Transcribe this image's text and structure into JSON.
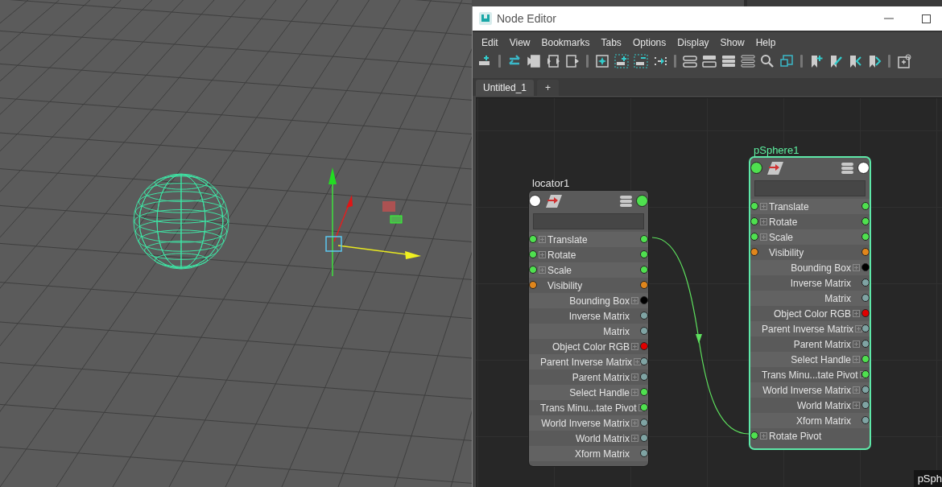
{
  "window": {
    "title": "Node Editor"
  },
  "menu": [
    "Edit",
    "View",
    "Bookmarks",
    "Tabs",
    "Options",
    "Display",
    "Show",
    "Help"
  ],
  "tabs": [
    {
      "label": "Untitled_1",
      "selected": true
    }
  ],
  "add_tab": "+",
  "nodes": [
    {
      "name": "locator1",
      "selected": false,
      "in_port": {
        "color": "#ffffff"
      },
      "out_port": {
        "color": "#4fe04f"
      },
      "rows": [
        {
          "kind": "both",
          "label": "Translate",
          "expandable": true,
          "in_port": {
            "color": "#4fe04f"
          },
          "out_port": {
            "color": "#4fe04f"
          }
        },
        {
          "kind": "both",
          "label": "Rotate",
          "expandable": true,
          "in_port": {
            "color": "#4fe04f"
          },
          "out_port": {
            "color": "#4fe04f"
          }
        },
        {
          "kind": "both",
          "label": "Scale",
          "expandable": true,
          "in_port": {
            "color": "#4fe04f"
          },
          "out_port": {
            "color": "#4fe04f"
          }
        },
        {
          "kind": "both",
          "label": "Visibility",
          "expandable": false,
          "in_port": {
            "color": "#e0861c"
          },
          "out_port": {
            "color": "#e0861c"
          }
        },
        {
          "kind": "output",
          "label": "Bounding Box",
          "expandable": true,
          "out_port": {
            "color": "#000000"
          }
        },
        {
          "kind": "output",
          "label": "Inverse Matrix",
          "expandable": false,
          "out_port": {
            "color": "#7fa3a3"
          }
        },
        {
          "kind": "output",
          "label": "Matrix",
          "expandable": false,
          "out_port": {
            "color": "#7fa3a3"
          }
        },
        {
          "kind": "output",
          "label": "Object Color RGB",
          "expandable": true,
          "out_port": {
            "color": "#e00000"
          }
        },
        {
          "kind": "output",
          "label": "Parent Inverse Matrix",
          "expandable": true,
          "out_port": {
            "color": "#7fa3a3"
          }
        },
        {
          "kind": "output",
          "label": "Parent Matrix",
          "expandable": true,
          "out_port": {
            "color": "#7fa3a3"
          }
        },
        {
          "kind": "output",
          "label": "Select Handle",
          "expandable": true,
          "out_port": {
            "color": "#4fe04f"
          }
        },
        {
          "kind": "output",
          "label": "Trans Minu...tate Pivot",
          "expandable": true,
          "out_port": {
            "color": "#4fe04f"
          }
        },
        {
          "kind": "output",
          "label": "World Inverse Matrix",
          "expandable": true,
          "out_port": {
            "color": "#7fa3a3"
          }
        },
        {
          "kind": "output",
          "label": "World Matrix",
          "expandable": true,
          "out_port": {
            "color": "#7fa3a3"
          }
        },
        {
          "kind": "output",
          "label": "Xform Matrix",
          "expandable": false,
          "out_port": {
            "color": "#7fa3a3"
          }
        }
      ]
    },
    {
      "name": "pSphere1",
      "selected": true,
      "in_port": {
        "color": "#4fe04f"
      },
      "out_port": {
        "color": "#ffffff"
      },
      "rows": [
        {
          "kind": "both",
          "label": "Translate",
          "expandable": true,
          "in_port": {
            "color": "#4fe04f"
          },
          "out_port": {
            "color": "#4fe04f"
          }
        },
        {
          "kind": "both",
          "label": "Rotate",
          "expandable": true,
          "in_port": {
            "color": "#4fe04f"
          },
          "out_port": {
            "color": "#4fe04f"
          }
        },
        {
          "kind": "both",
          "label": "Scale",
          "expandable": true,
          "in_port": {
            "color": "#4fe04f"
          },
          "out_port": {
            "color": "#4fe04f"
          }
        },
        {
          "kind": "both",
          "label": "Visibility",
          "expandable": false,
          "in_port": {
            "color": "#e0861c"
          },
          "out_port": {
            "color": "#e0861c"
          }
        },
        {
          "kind": "output",
          "label": "Bounding Box",
          "expandable": true,
          "out_port": {
            "color": "#000000"
          }
        },
        {
          "kind": "output",
          "label": "Inverse Matrix",
          "expandable": false,
          "out_port": {
            "color": "#7fa3a3"
          }
        },
        {
          "kind": "output",
          "label": "Matrix",
          "expandable": false,
          "out_port": {
            "color": "#7fa3a3"
          }
        },
        {
          "kind": "output",
          "label": "Object Color RGB",
          "expandable": true,
          "out_port": {
            "color": "#e00000"
          }
        },
        {
          "kind": "output",
          "label": "Parent Inverse Matrix",
          "expandable": true,
          "out_port": {
            "color": "#7fa3a3"
          }
        },
        {
          "kind": "output",
          "label": "Parent Matrix",
          "expandable": true,
          "out_port": {
            "color": "#7fa3a3"
          }
        },
        {
          "kind": "output",
          "label": "Select Handle",
          "expandable": true,
          "out_port": {
            "color": "#4fe04f"
          }
        },
        {
          "kind": "output",
          "label": "Trans Minu...tate Pivot",
          "expandable": true,
          "out_port": {
            "color": "#4fe04f"
          }
        },
        {
          "kind": "output",
          "label": "World Inverse Matrix",
          "expandable": true,
          "out_port": {
            "color": "#7fa3a3"
          }
        },
        {
          "kind": "output",
          "label": "World Matrix",
          "expandable": true,
          "out_port": {
            "color": "#7fa3a3"
          }
        },
        {
          "kind": "output",
          "label": "Xform Matrix",
          "expandable": false,
          "out_port": {
            "color": "#7fa3a3"
          }
        },
        {
          "kind": "input",
          "label": "Rotate Pivot",
          "expandable": true,
          "in_port": {
            "color": "#4fe04f"
          }
        }
      ]
    }
  ],
  "corner_label": "pSph"
}
